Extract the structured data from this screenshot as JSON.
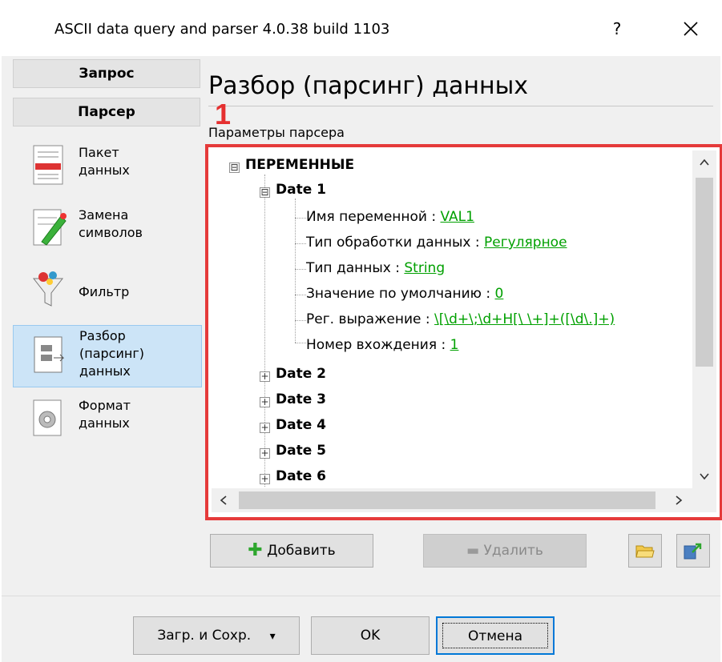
{
  "window": {
    "title": "ASCII data query and parser 4.0.38 build 1103",
    "help_label": "?",
    "close_icon": "close-icon"
  },
  "nav": {
    "query_label": "Запрос",
    "parser_label": "Парсер",
    "items": [
      {
        "label": "Пакет\nданных",
        "icon": "packet-data-icon"
      },
      {
        "label": "Замена\nсимволов",
        "icon": "replace-chars-icon"
      },
      {
        "label": "Фильтр",
        "icon": "filter-icon"
      },
      {
        "label": "Разбор\n(парсинг)\nданных",
        "icon": "parse-data-icon",
        "selected": true
      },
      {
        "label": "Формат\nданных",
        "icon": "format-data-icon"
      }
    ]
  },
  "main": {
    "heading": "Разбор (парсинг) данных",
    "marker_number": "1",
    "params_label": "Параметры парсера"
  },
  "tree": {
    "root": {
      "label": "ПЕРЕМЕННЫЕ",
      "expander": "⊟"
    },
    "date1": {
      "label": "Date 1",
      "expander": "⊟",
      "props": [
        {
          "name": "Имя переменной : ",
          "value": "VAL1"
        },
        {
          "name": "Тип обработки данных : ",
          "value": "Регулярное"
        },
        {
          "name": "Тип данных : ",
          "value": "String"
        },
        {
          "name": "Значение по умолчанию : ",
          "value": "0"
        },
        {
          "name": "Рег. выражение : ",
          "value": "\\[\\d+\\;\\d+H[\\ \\+]+([\\d\\.]+)"
        },
        {
          "name": "Номер вхождения : ",
          "value": "1"
        }
      ]
    },
    "collapsed": [
      {
        "label": "Date 2",
        "expander": "+"
      },
      {
        "label": "Date 3",
        "expander": "+"
      },
      {
        "label": "Date 4",
        "expander": "+"
      },
      {
        "label": "Date 5",
        "expander": "+"
      },
      {
        "label": "Date 6",
        "expander": "+"
      }
    ]
  },
  "actions": {
    "add_label": "Добавить",
    "delete_label": "Удалить"
  },
  "footer": {
    "load_save_label": "Загр. и Сохр.",
    "dropdown_arrow": "▾",
    "ok_label": "OK",
    "cancel_label": "Отмена"
  },
  "colors": {
    "accent_red": "#e53a3a",
    "link_green": "#00a000",
    "selected_nav": "#cce4f7"
  }
}
